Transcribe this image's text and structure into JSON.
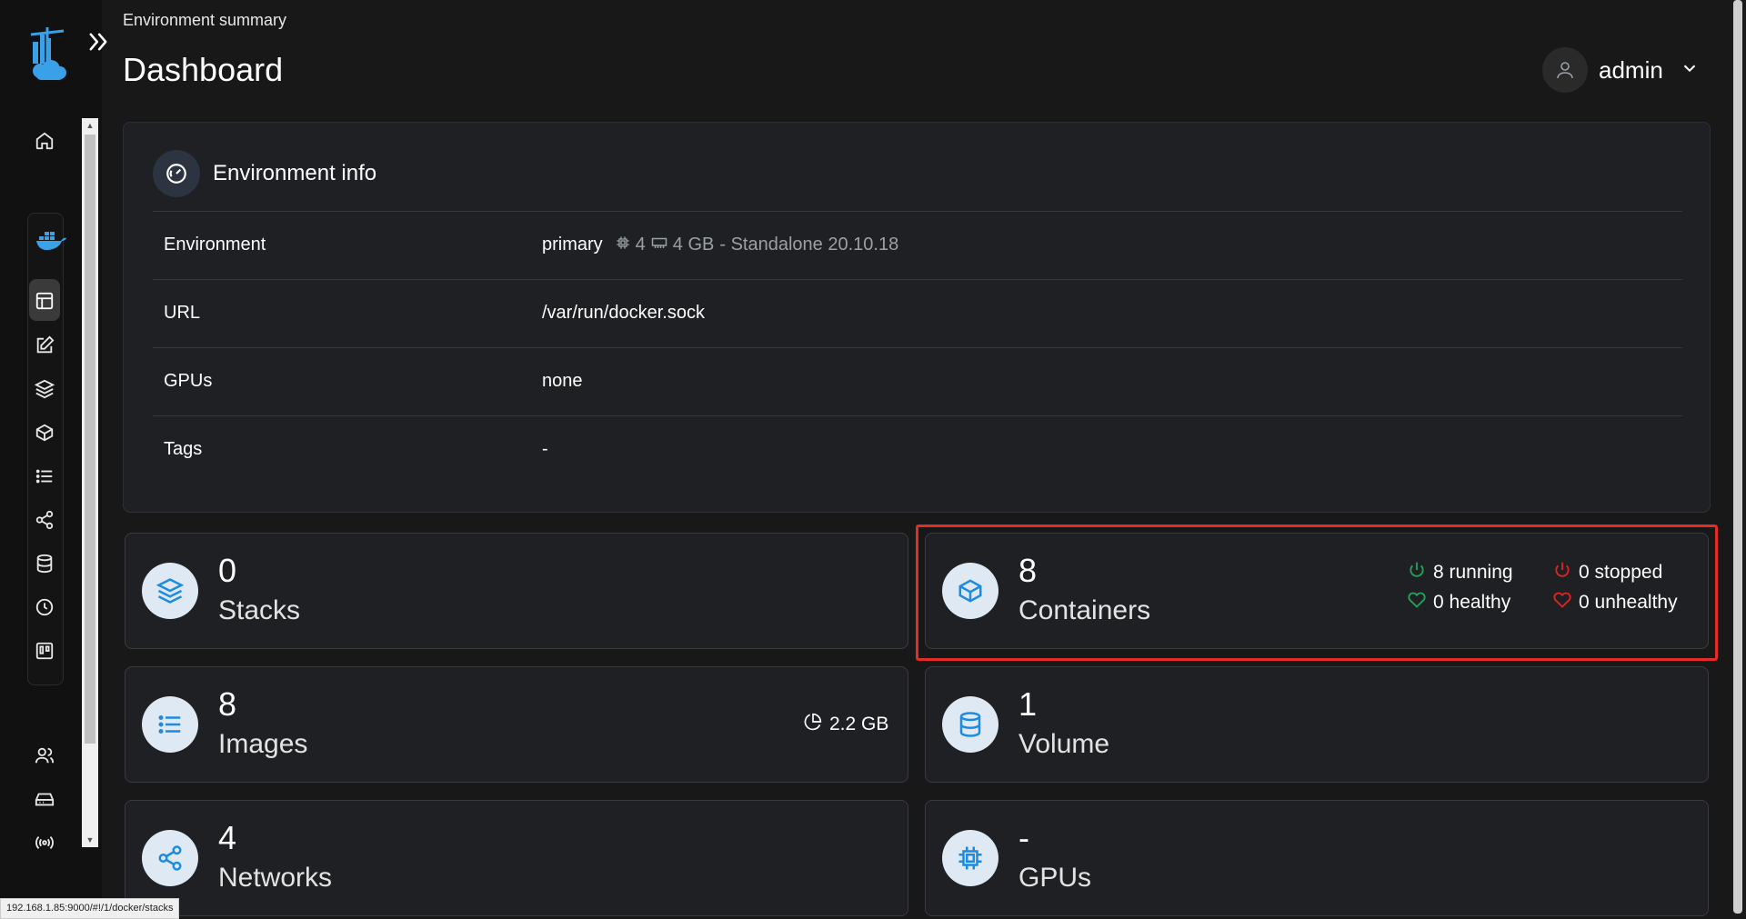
{
  "header": {
    "breadcrumb": "Environment summary",
    "title": "Dashboard",
    "username": "admin"
  },
  "env_info": {
    "title": "Environment info",
    "rows": [
      {
        "label": "Environment",
        "value": "primary",
        "cpu": "4",
        "memory": "4 GB",
        "type": "- Standalone 20.10.18"
      },
      {
        "label": "URL",
        "value": "/var/run/docker.sock"
      },
      {
        "label": "GPUs",
        "value": "none"
      },
      {
        "label": "Tags",
        "value": "-"
      }
    ]
  },
  "stats": {
    "stacks": {
      "count": "0",
      "label": "Stacks"
    },
    "containers": {
      "count": "8",
      "label": "Containers",
      "running": "8 running",
      "stopped": "0 stopped",
      "healthy": "0 healthy",
      "unhealthy": "0 unhealthy"
    },
    "images": {
      "count": "8",
      "label": "Images",
      "size": "2.2 GB"
    },
    "volumes": {
      "count": "1",
      "label": "Volume"
    },
    "networks": {
      "count": "4",
      "label": "Networks"
    },
    "gpus": {
      "count": "-",
      "label": "GPUs"
    }
  },
  "status_bar": {
    "url": "192.168.1.85:9000/#!/1/docker/stacks"
  },
  "colors": {
    "accent": "#3aa0e8",
    "running": "#25a25a",
    "stopped": "#e02424",
    "highlight": "#e32b27"
  }
}
